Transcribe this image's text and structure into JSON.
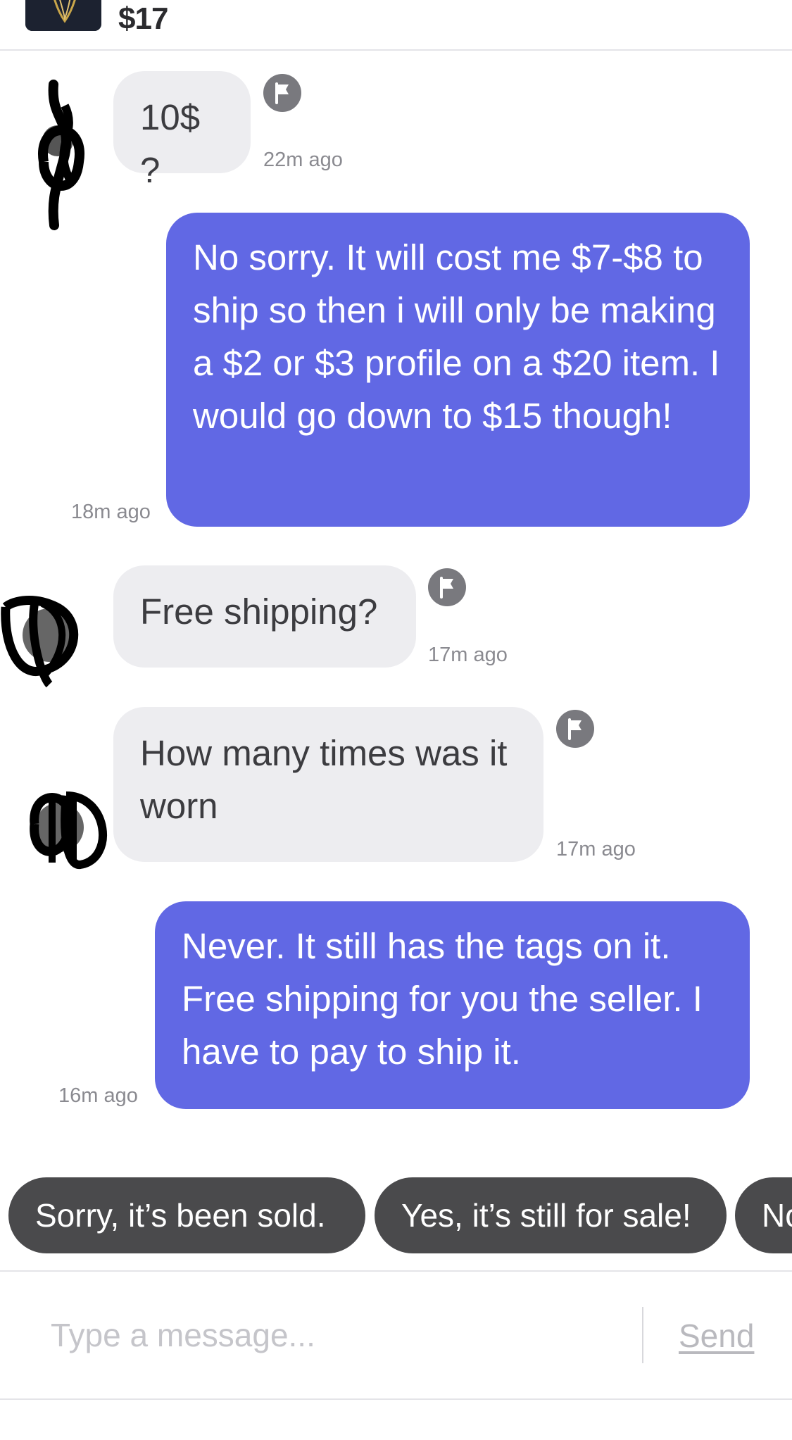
{
  "header": {
    "price": "$17",
    "thumbnail_icon": "listing-photo"
  },
  "messages": [
    {
      "direction": "incoming",
      "text": "10$ ?",
      "time": "22m ago",
      "flagged_icon": "flag-icon"
    },
    {
      "direction": "outgoing",
      "text": "No sorry. It will cost me $7-$8 to ship so then i will only be making a $2 or $3 profile on a $20 item. I would go down to $15 though!",
      "time": "18m ago"
    },
    {
      "direction": "incoming",
      "text": "Free shipping?",
      "time": "17m ago",
      "flagged_icon": "flag-icon"
    },
    {
      "direction": "incoming",
      "text": "How many times was it worn",
      "time": "17m ago",
      "flagged_icon": "flag-icon"
    },
    {
      "direction": "outgoing",
      "text": "Never. It still has the tags on it. Free shipping for you the seller. I have to pay to ship it.",
      "time": "16m ago"
    }
  ],
  "quick_replies": [
    "Sorry, it’s been sold.",
    "Yes, it’s still for sale!",
    "No"
  ],
  "composer": {
    "placeholder": "Type a message...",
    "send_label": "Send"
  },
  "colors": {
    "outgoing_bubble": "#6168e4",
    "incoming_bubble": "#ededf0",
    "chip_background": "#4a4a4c",
    "timestamp": "#8a8a90"
  }
}
